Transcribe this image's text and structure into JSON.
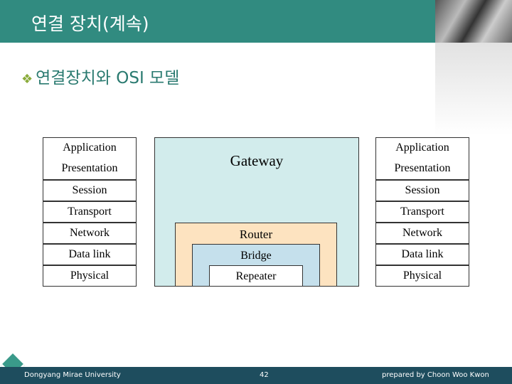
{
  "header": {
    "title": "연결 장치(계속)"
  },
  "subtitle": "연결장치와 OSI 모델",
  "left_stack": [
    "Application",
    "Presentation",
    "Session",
    "Transport",
    "Network",
    "Data link",
    "Physical"
  ],
  "right_stack": [
    "Application",
    "Presentation",
    "Session",
    "Transport",
    "Network",
    "Data link",
    "Physical"
  ],
  "devices": {
    "gateway": "Gateway",
    "router": "Router",
    "bridge": "Bridge",
    "repeater": "Repeater"
  },
  "colors": {
    "header": "#318b80",
    "gateway": "#d2ecec",
    "router": "#fde3c0",
    "bridge": "#c5e0ec",
    "footer": "#1e4d5e"
  },
  "footer": {
    "left": "Dongyang Mirae University",
    "page": "42",
    "right": "prepared by Choon Woo Kwon"
  }
}
